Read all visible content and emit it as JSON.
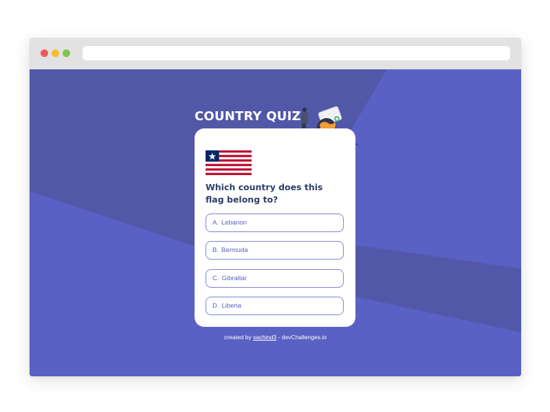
{
  "browser": {
    "controls": [
      "close",
      "minimize",
      "maximize"
    ],
    "address_bar": ""
  },
  "app": {
    "title": "COUNTRY QUIZ"
  },
  "quiz": {
    "flag_icon": "liberia-flag-icon",
    "question": "Which country does this flag belong to?",
    "options": [
      {
        "letter": "A.",
        "text": "Lebanon"
      },
      {
        "letter": "B.",
        "text": "Bermuda"
      },
      {
        "letter": "C.",
        "text": "Gibraltar"
      },
      {
        "letter": "D.",
        "text": "Liberia"
      }
    ]
  },
  "footer": {
    "prefix": "created by",
    "author": "sachind3",
    "suffix": "- devChallenges.io"
  },
  "colors": {
    "background": "#5a61c4",
    "background_dark": "#5258a8",
    "card": "#ffffff",
    "question_text": "#2f3f6b",
    "option_border": "#7e82d6",
    "option_text": "#5a61c4"
  }
}
